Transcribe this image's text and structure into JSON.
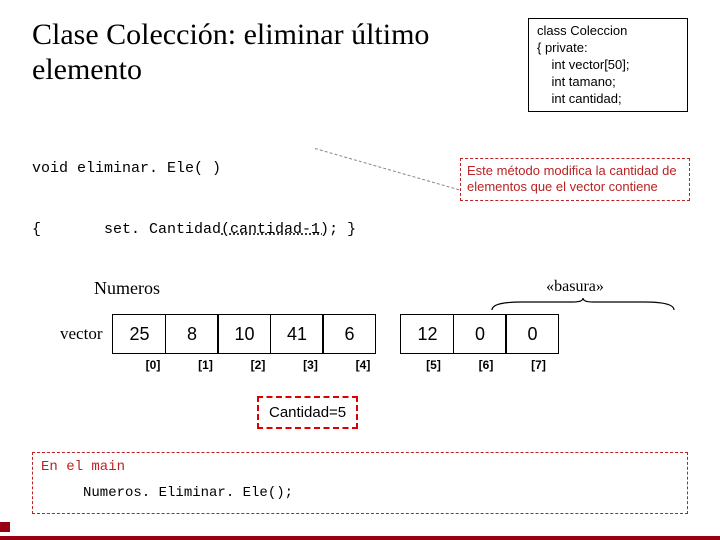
{
  "title": "Clase Colección: eliminar último elemento",
  "classbox": {
    "l1": "class Coleccion",
    "l2": "{ private:",
    "l3": "    int vector[50];",
    "l4": "    int tamano;",
    "l5": "    int cantidad;"
  },
  "code": {
    "l1": "void eliminar. Ele( )",
    "l2_a": "{       set. Cantidad",
    "l2_b": "(cantidad-1)",
    "l2_c": "; }"
  },
  "numeros_label": "Numeros",
  "note": "Este método modifica la cantidad de elementos que el vector contiene",
  "basura": "«basura»",
  "vector_label": "vector",
  "chart_data": {
    "type": "table",
    "cells": [
      "25",
      "8",
      "10",
      "41",
      "6",
      "12",
      "0",
      "0"
    ],
    "indices": [
      "[0]",
      "[1]",
      "[2]",
      "[3]",
      "[4]",
      "[5]",
      "[6]",
      "[7]"
    ],
    "split_after": 5,
    "garbage_start_index": 5
  },
  "cantidad_label": "Cantidad=5",
  "main_l1": "En el main",
  "main_l2": "Numeros. Eliminar. Ele();"
}
